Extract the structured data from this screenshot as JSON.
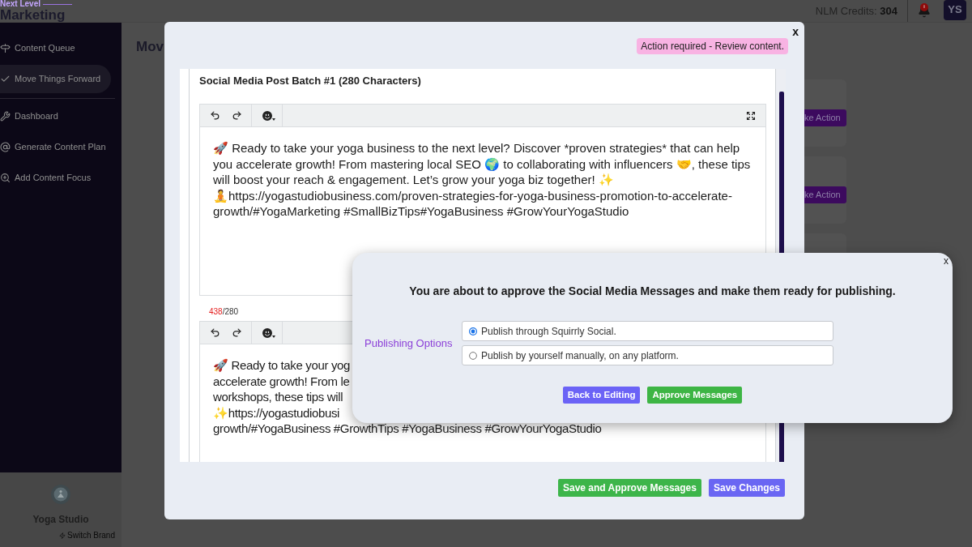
{
  "header": {
    "logo": {
      "tagline": "Next Level",
      "name": "Marketing"
    },
    "credits": {
      "label": "NLM Credits:",
      "value": "304"
    },
    "avatar": "YS"
  },
  "sidebar": {
    "sections": [
      {
        "items": [
          {
            "label": "Content Queue",
            "selected": false
          },
          {
            "label": "Move Things Forward",
            "selected": true
          }
        ]
      },
      {
        "items": [
          {
            "label": "Dashboard",
            "selected": false
          },
          {
            "label": "Generate Content Plan",
            "selected": false
          },
          {
            "label": "Add Content Focus",
            "selected": false
          }
        ]
      }
    ],
    "brand": {
      "name": "Yoga Studio",
      "switch_label": "Switch Brand"
    }
  },
  "main": {
    "title": "Mov",
    "cards": [
      {
        "kind": "action",
        "button": "ke Action"
      },
      {
        "kind": "action",
        "button": "ke Action"
      },
      {
        "kind": "plain"
      }
    ]
  },
  "modal": {
    "close": "x",
    "badge": "Action required - Review content.",
    "section_title": "Social Media Post Batch #1 (280 Characters)",
    "editors": [
      {
        "text": "🚀 Ready to take your yoga business to the next level? Discover *proven strategies* that can help you accelerate growth! From mastering local SEO 🌍 to collaborating with influencers 🤝, these tips will boost your reach & engagement. Let’s grow your yoga biz together! ✨\n🧘https://yogastudiobusiness.com/proven-strategies-for-yoga-business-promotion-to-accelerate-growth/#YogaMarketing #SmallBizTips#YogaBusiness #GrowYourYogaStudio",
        "counter": {
          "used": "438",
          "rest": "/280",
          "over": true
        }
      },
      {
        "lines": [
          "🚀 Ready to take your yog",
          "accelerate growth! From le",
          "workshops, these tips will",
          "✨https://yogastudiobusi",
          "growth/#YogaBusiness #GrowthTips #YogaBusiness #GrowYourYogaStudio"
        ]
      }
    ],
    "buttons": [
      {
        "label": "Save and Approve Messages",
        "kind": "approve"
      },
      {
        "label": "Save Changes",
        "kind": "save"
      }
    ]
  },
  "dialog": {
    "close": "x",
    "message": "You are about to approve the Social Media Messages and make them ready for publishing.",
    "options_label": "Publishing Options",
    "options": [
      {
        "label": "Publish through Squirrly Social.",
        "selected": true
      },
      {
        "label": "Publish by yourself manually, on any platform.",
        "selected": false
      }
    ],
    "buttons": [
      {
        "label": "Back to Editing",
        "kind": "back"
      },
      {
        "label": "Approve Messages",
        "kind": "approve"
      }
    ]
  }
}
